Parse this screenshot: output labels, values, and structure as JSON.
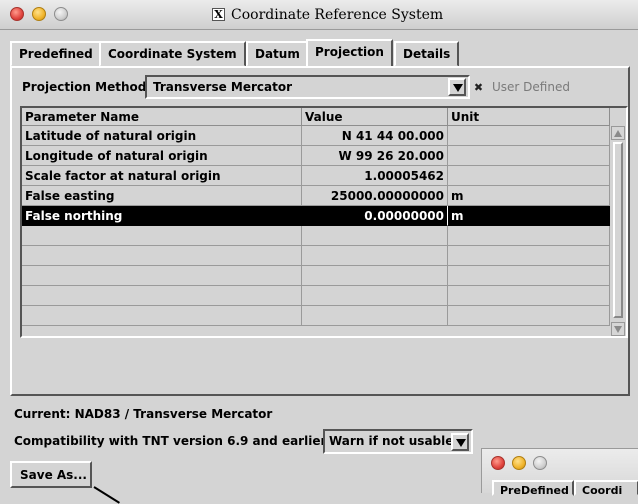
{
  "window": {
    "title": "Coordinate Reference System",
    "x_icon": "X"
  },
  "tabs": [
    {
      "label": "Predefined",
      "active": false
    },
    {
      "label": "Coordinate System",
      "active": false
    },
    {
      "label": "Datum",
      "active": false
    },
    {
      "label": "Projection",
      "active": true
    },
    {
      "label": "Details",
      "active": false
    }
  ],
  "projection": {
    "method_label": "Projection Method",
    "method_value": "Transverse Mercator",
    "user_defined_label": "User Defined",
    "user_defined_checked": true,
    "check_glyph": "✖"
  },
  "table": {
    "headers": [
      "Parameter Name",
      "Value",
      "Unit"
    ],
    "rows": [
      {
        "name": "Latitude of natural origin",
        "value": "N 41 44 00.000",
        "unit": ""
      },
      {
        "name": "Longitude of natural origin",
        "value": "W 99 26 20.000",
        "unit": ""
      },
      {
        "name": "Scale factor at natural origin",
        "value": "1.00005462",
        "unit": ""
      },
      {
        "name": "False easting",
        "value": "25000.00000000",
        "unit": "m"
      },
      {
        "name": "False northing",
        "value": "0.00000000",
        "unit": "m",
        "selected": true
      },
      {
        "name": "",
        "value": "",
        "unit": ""
      },
      {
        "name": "",
        "value": "",
        "unit": ""
      },
      {
        "name": "",
        "value": "",
        "unit": ""
      },
      {
        "name": "",
        "value": "",
        "unit": ""
      },
      {
        "name": "",
        "value": "",
        "unit": ""
      }
    ]
  },
  "status": {
    "current": "Current: NAD83 / Transverse Mercator",
    "compat_label": "Compatibility with TNT version 6.9 and earlier:",
    "compat_value": "Warn if not usable"
  },
  "buttons": {
    "save_as": "Save As..."
  },
  "second_window": {
    "tabs": [
      "PreDefined",
      "Coordi"
    ]
  },
  "colors": {
    "background": "#d4d4d4",
    "selection": "#000000"
  }
}
